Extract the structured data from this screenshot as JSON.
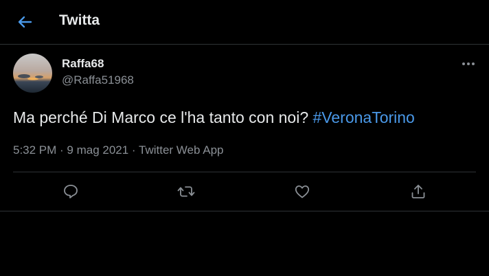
{
  "header": {
    "title": "Twitta",
    "back_icon": "arrow-left-icon"
  },
  "tweet": {
    "author_name": "Raffa68",
    "author_handle": "@Raffa51968",
    "text_prefix": "Ma perché Di Marco ce l'ha tanto con noi? ",
    "hashtag": "#VeronaTorino",
    "timestamp": "5:32 PM · 9 mag 2021 · Twitter Web App",
    "more_icon": "more-horizontal-icon"
  },
  "actions": [
    {
      "icon": "reply-icon"
    },
    {
      "icon": "retweet-icon"
    },
    {
      "icon": "like-icon"
    },
    {
      "icon": "share-icon"
    }
  ],
  "colors": {
    "background": "#000000",
    "accent": "#4a99e9",
    "secondary_text": "#8b9096",
    "divider": "#2f3336"
  }
}
